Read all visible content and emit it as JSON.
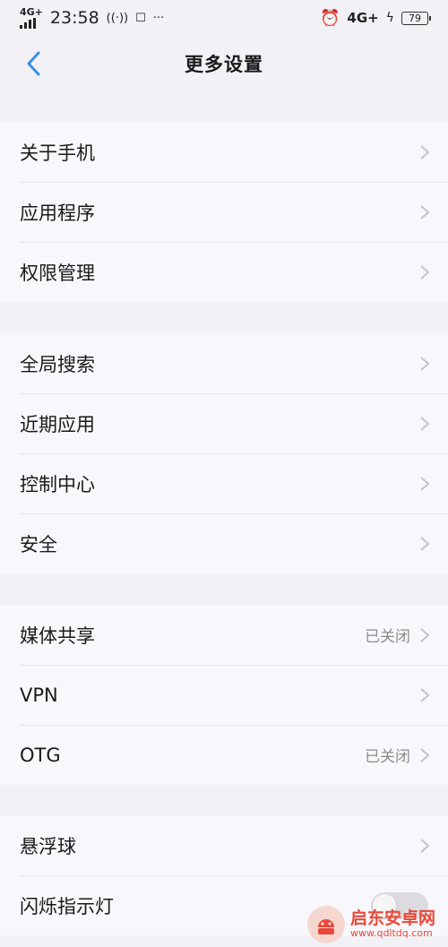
{
  "status_bar": {
    "network_left": "4G+",
    "time": "23:58",
    "network_right": "4G+",
    "battery": "79"
  },
  "header": {
    "title": "更多设置"
  },
  "groups": [
    {
      "items": [
        {
          "label": "关于手机"
        },
        {
          "label": "应用程序"
        },
        {
          "label": "权限管理"
        }
      ]
    },
    {
      "items": [
        {
          "label": "全局搜索"
        },
        {
          "label": "近期应用"
        },
        {
          "label": "控制中心"
        },
        {
          "label": "安全"
        }
      ]
    },
    {
      "items": [
        {
          "label": "媒体共享",
          "value": "已关闭"
        },
        {
          "label": "VPN"
        },
        {
          "label": "OTG",
          "value": "已关闭"
        }
      ]
    },
    {
      "items": [
        {
          "label": "悬浮球"
        },
        {
          "label": "闪烁指示灯",
          "toggle": false
        }
      ]
    }
  ],
  "watermark": {
    "name": "启东安卓网",
    "url": "www.qdltdq.com"
  },
  "colors": {
    "accent": "#3a8ee6",
    "chevron": "#c4c4c8",
    "value_text": "#8c8c8c"
  }
}
